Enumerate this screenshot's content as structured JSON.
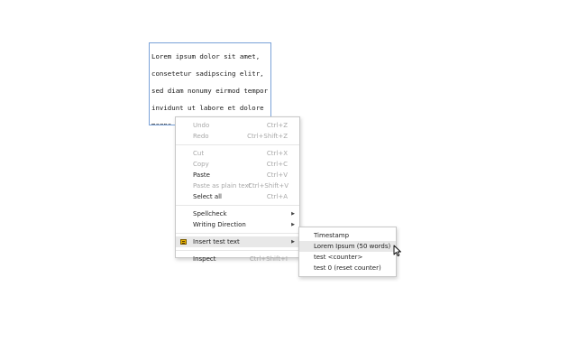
{
  "textarea": {
    "text": "Lorem ipsum dolor sit amet, consetetur sadipscing elitr, sed diam nonumy eirmod tempor invidunt ut labore et dolore magna aliquyam erat, sed diam voluptua. At vero eos et accusam et justo duo dolores et ea rebum. Stet clita kasd gubergren, no sea takimata sanctus est Lorem ipsum dolor sit amet."
  },
  "context_menu": {
    "undo": {
      "label": "Undo",
      "shortcut": "Ctrl+Z"
    },
    "redo": {
      "label": "Redo",
      "shortcut": "Ctrl+Shift+Z"
    },
    "cut": {
      "label": "Cut",
      "shortcut": "Ctrl+X"
    },
    "copy": {
      "label": "Copy",
      "shortcut": "Ctrl+C"
    },
    "paste": {
      "label": "Paste",
      "shortcut": "Ctrl+V"
    },
    "paste_plain": {
      "label": "Paste as plain text",
      "shortcut": "Ctrl+Shift+V"
    },
    "select_all": {
      "label": "Select all",
      "shortcut": "Ctrl+A"
    },
    "spellcheck": {
      "label": "Spellcheck"
    },
    "writing_direction": {
      "label": "Writing Direction"
    },
    "insert_test_text": {
      "label": "Insert test text",
      "icon": "extension-icon"
    },
    "inspect": {
      "label": "Inspect",
      "shortcut": "Ctrl+Shift+I"
    }
  },
  "submenu": {
    "items": [
      {
        "label": "Timestamp"
      },
      {
        "label": "Lorem Ipsum (50 words)"
      },
      {
        "label": "test <counter>"
      },
      {
        "label": "test 0 (reset counter)"
      }
    ]
  },
  "icons": {
    "submenu_arrow": "submenu-arrow-icon",
    "cursor": "mouse-pointer-icon"
  }
}
